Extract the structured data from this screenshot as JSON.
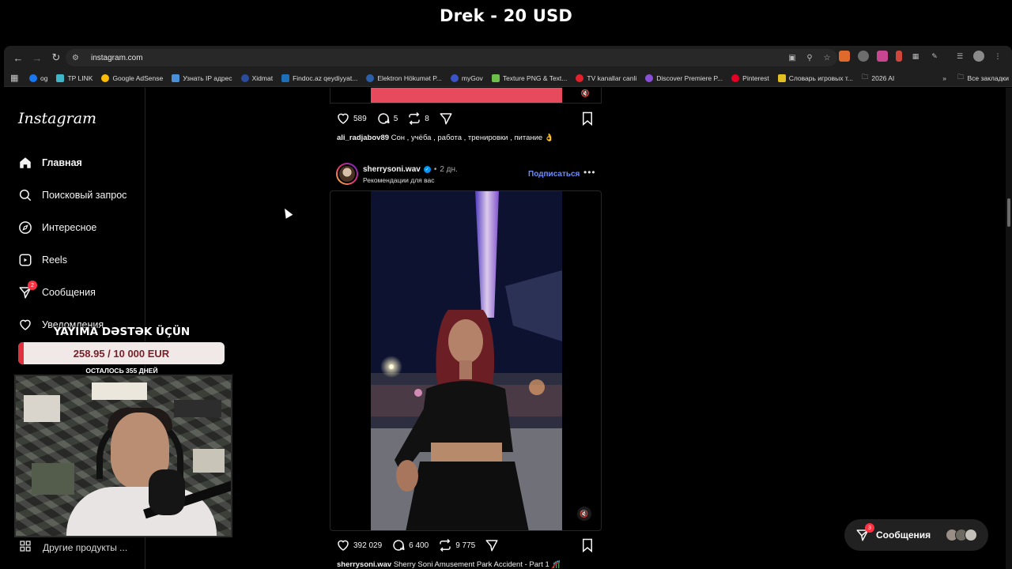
{
  "stream": {
    "title": "Drek - 20 USD",
    "support_title": "YAYIMA DƏSTƏK ÜÇÜN",
    "goal_text": "258.95 / 10 000 EUR",
    "goal_fraction": 0.0259,
    "goal_color": "#e0313f",
    "days_left": "ОСТАЛОСЬ 355 ДНЕЙ"
  },
  "browser": {
    "url": "instagram.com",
    "bookmarks": [
      {
        "label": "og",
        "color": "#1877f2"
      },
      {
        "label": "TP LINK",
        "color": "#3cb6c8"
      },
      {
        "label": "Google AdSense",
        "color": "#fbbc05"
      },
      {
        "label": "Узнать IP адрес",
        "color": "#4a90d9"
      },
      {
        "label": "Xidmat",
        "color": "#2a4c9a"
      },
      {
        "label": "Findoc.az qeydiyyat...",
        "color": "#1d6fb8"
      },
      {
        "label": "Elektron Hökumət P...",
        "color": "#2b5fa8"
      },
      {
        "label": "myGov",
        "color": "#3a53c6"
      },
      {
        "label": "Texture PNG & Text...",
        "color": "#6cc04a"
      },
      {
        "label": "TV kanallar canli",
        "color": "#e3202c"
      },
      {
        "label": "Discover Premiere P...",
        "color": "#8a4fd8"
      },
      {
        "label": "Pinterest",
        "color": "#e60023"
      },
      {
        "label": "Словарь игровых т...",
        "color": "#e3c022"
      },
      {
        "label": "2026 AI",
        "color": "folder"
      }
    ],
    "all_bookmarks": "Все закладки"
  },
  "sidebar": {
    "logo": "Instagram",
    "items": [
      {
        "label": "Главная",
        "icon": "home-icon",
        "active": true
      },
      {
        "label": "Поисковый запрос",
        "icon": "search-icon"
      },
      {
        "label": "Интересное",
        "icon": "compass-icon"
      },
      {
        "label": "Reels",
        "icon": "reels-icon"
      },
      {
        "label": "Сообщения",
        "icon": "messenger-icon",
        "badge": "2"
      },
      {
        "label": "Уведомления",
        "icon": "heart-icon"
      }
    ],
    "other_products": "Другие продукты ..."
  },
  "feed": {
    "prev_post": {
      "likes": "589",
      "comments": "5",
      "reposts": "8",
      "username": "ali_radjabov89",
      "caption": "Сон , учёба , работа , тренировки , питание 👌"
    },
    "post": {
      "username": "sherrysoni.wav",
      "time": "2 дн.",
      "subtitle": "Рекомендации для вас",
      "follow_label": "Подписаться",
      "likes": "392 029",
      "comments": "6 400",
      "reposts": "9 775",
      "caption_user": "sherrysoni.wav",
      "caption": "Sherry Soni Amusement Park Accident - Part 1 🎢"
    }
  },
  "messages_pill": {
    "label": "Сообщения",
    "badge": "3"
  }
}
